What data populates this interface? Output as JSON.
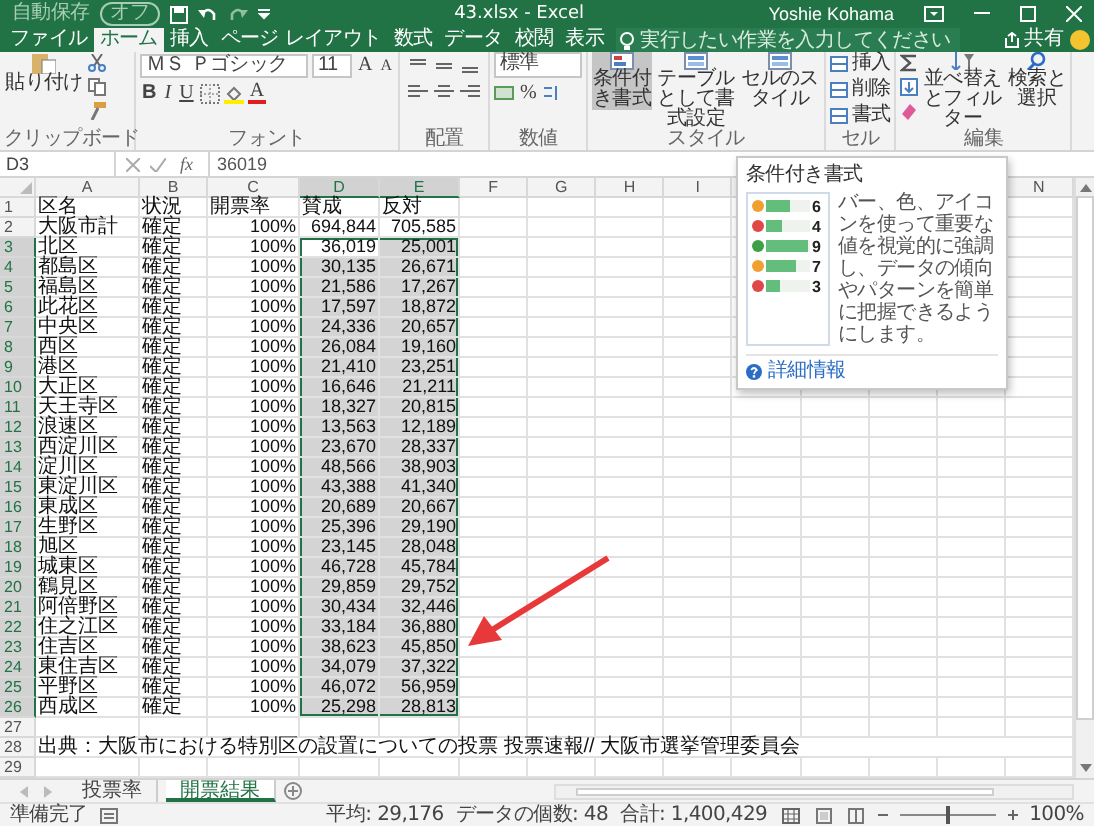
{
  "title_bar": {
    "autosave_label": "自動保存",
    "autosave_toggle": "オフ",
    "document_title": "43.xlsx - Excel",
    "user": "Yoshie Kohama"
  },
  "tabs": [
    {
      "label": "ファイル",
      "selected": false
    },
    {
      "label": "ホーム",
      "selected": true
    },
    {
      "label": "挿入",
      "selected": false
    },
    {
      "label": "ページ レイアウト",
      "selected": false
    },
    {
      "label": "数式",
      "selected": false
    },
    {
      "label": "データ",
      "selected": false
    },
    {
      "label": "校閲",
      "selected": false
    },
    {
      "label": "表示",
      "selected": false
    }
  ],
  "tell_me": {
    "placeholder": "実行したい作業を入力してください"
  },
  "share": "共有",
  "ribbon": {
    "groups": [
      {
        "kind": "clipboard",
        "label": "クリップボード",
        "buttons": [
          "貼り付け"
        ]
      },
      {
        "kind": "font",
        "label": "フォント",
        "font_name": "ＭＳ Ｐゴシック",
        "font_size": "11",
        "grow_shrink": [
          "A",
          "A"
        ],
        "styles": [
          "B",
          "I",
          "U"
        ],
        "font_color": "A"
      },
      {
        "kind": "alignment",
        "label": "配置"
      },
      {
        "kind": "number",
        "label": "数値",
        "format": "標準",
        "percent": "%"
      },
      {
        "kind": "style",
        "label": "スタイル",
        "buttons": [
          {
            "label": "条件付き書式",
            "selected": true
          },
          {
            "label": "テーブルとして書式設定",
            "selected": false
          },
          {
            "label": "セルのスタイル",
            "selected": false
          }
        ]
      },
      {
        "kind": "cells",
        "label": "セル",
        "buttons": [
          "挿入",
          "削除",
          "書式"
        ]
      },
      {
        "kind": "editing",
        "label": "編集",
        "buttons": [
          "並べ替えとフィルター",
          "検索と選択"
        ]
      }
    ]
  },
  "formula_bar": {
    "name_box": "D3",
    "function_glyph": "fx",
    "formula": "36019"
  },
  "columns": [
    {
      "label": "A",
      "selected": false
    },
    {
      "label": "B",
      "selected": false
    },
    {
      "label": "C",
      "selected": false
    },
    {
      "label": "D",
      "selected": true
    },
    {
      "label": "E",
      "selected": true
    },
    {
      "label": "F",
      "selected": false
    },
    {
      "label": "G",
      "selected": false
    },
    {
      "label": "H",
      "selected": false
    },
    {
      "label": "I",
      "selected": false
    },
    {
      "label": "N",
      "selected": false
    }
  ],
  "rows": [
    {
      "num": "1",
      "kind": "header",
      "selected": false,
      "cells": [
        "区名",
        "状況",
        "開票率",
        "賛成",
        "反対"
      ]
    },
    {
      "num": "2",
      "kind": "data",
      "selected": false,
      "cells": [
        "大阪市計",
        "確定",
        "100%",
        "694,844",
        "705,585"
      ]
    },
    {
      "num": "3",
      "kind": "data",
      "selected": true,
      "active": true,
      "cells": [
        "北区",
        "確定",
        "100%",
        "36,019",
        "25,001"
      ]
    },
    {
      "num": "4",
      "kind": "data",
      "selected": true,
      "cells": [
        "都島区",
        "確定",
        "100%",
        "30,135",
        "26,671"
      ]
    },
    {
      "num": "5",
      "kind": "data",
      "selected": true,
      "cells": [
        "福島区",
        "確定",
        "100%",
        "21,586",
        "17,267"
      ]
    },
    {
      "num": "6",
      "kind": "data",
      "selected": true,
      "cells": [
        "此花区",
        "確定",
        "100%",
        "17,597",
        "18,872"
      ]
    },
    {
      "num": "7",
      "kind": "data",
      "selected": true,
      "cells": [
        "中央区",
        "確定",
        "100%",
        "24,336",
        "20,657"
      ]
    },
    {
      "num": "8",
      "kind": "data",
      "selected": true,
      "cells": [
        "西区",
        "確定",
        "100%",
        "26,084",
        "19,160"
      ]
    },
    {
      "num": "9",
      "kind": "data",
      "selected": true,
      "cells": [
        "港区",
        "確定",
        "100%",
        "21,410",
        "23,251"
      ]
    },
    {
      "num": "10",
      "kind": "data",
      "selected": true,
      "cells": [
        "大正区",
        "確定",
        "100%",
        "16,646",
        "21,211"
      ]
    },
    {
      "num": "11",
      "kind": "data",
      "selected": true,
      "cells": [
        "天王寺区",
        "確定",
        "100%",
        "18,327",
        "20,815"
      ]
    },
    {
      "num": "12",
      "kind": "data",
      "selected": true,
      "cells": [
        "浪速区",
        "確定",
        "100%",
        "13,563",
        "12,189"
      ]
    },
    {
      "num": "13",
      "kind": "data",
      "selected": true,
      "cells": [
        "西淀川区",
        "確定",
        "100%",
        "23,670",
        "28,337"
      ]
    },
    {
      "num": "14",
      "kind": "data",
      "selected": true,
      "cells": [
        "淀川区",
        "確定",
        "100%",
        "48,566",
        "38,903"
      ]
    },
    {
      "num": "15",
      "kind": "data",
      "selected": true,
      "cells": [
        "東淀川区",
        "確定",
        "100%",
        "43,388",
        "41,340"
      ]
    },
    {
      "num": "16",
      "kind": "data",
      "selected": true,
      "cells": [
        "東成区",
        "確定",
        "100%",
        "20,689",
        "20,667"
      ]
    },
    {
      "num": "17",
      "kind": "data",
      "selected": true,
      "cells": [
        "生野区",
        "確定",
        "100%",
        "25,396",
        "29,190"
      ]
    },
    {
      "num": "18",
      "kind": "data",
      "selected": true,
      "cells": [
        "旭区",
        "確定",
        "100%",
        "23,145",
        "28,048"
      ]
    },
    {
      "num": "19",
      "kind": "data",
      "selected": true,
      "cells": [
        "城東区",
        "確定",
        "100%",
        "46,728",
        "45,784"
      ]
    },
    {
      "num": "20",
      "kind": "data",
      "selected": true,
      "cells": [
        "鶴見区",
        "確定",
        "100%",
        "29,859",
        "29,752"
      ]
    },
    {
      "num": "21",
      "kind": "data",
      "selected": true,
      "cells": [
        "阿倍野区",
        "確定",
        "100%",
        "30,434",
        "32,446"
      ]
    },
    {
      "num": "22",
      "kind": "data",
      "selected": true,
      "cells": [
        "住之江区",
        "確定",
        "100%",
        "33,184",
        "36,880"
      ]
    },
    {
      "num": "23",
      "kind": "data",
      "selected": true,
      "cells": [
        "住吉区",
        "確定",
        "100%",
        "38,623",
        "45,850"
      ]
    },
    {
      "num": "24",
      "kind": "data",
      "selected": true,
      "cells": [
        "東住吉区",
        "確定",
        "100%",
        "34,079",
        "37,322"
      ]
    },
    {
      "num": "25",
      "kind": "data",
      "selected": true,
      "cells": [
        "平野区",
        "確定",
        "100%",
        "46,072",
        "56,959"
      ]
    },
    {
      "num": "26",
      "kind": "data",
      "selected": true,
      "cells": [
        "西成区",
        "確定",
        "100%",
        "25,298",
        "28,813"
      ]
    },
    {
      "num": "27",
      "kind": "empty",
      "selected": false
    },
    {
      "num": "28",
      "kind": "note",
      "selected": false,
      "note": "出典：大阪市における特別区の設置についての投票 投票速報// 大阪市選挙管理委員会"
    },
    {
      "num": "29",
      "kind": "empty",
      "selected": false
    }
  ],
  "tooltip": {
    "title": "条件付き書式",
    "sample": [
      {
        "value": "6",
        "color": "#f0a030",
        "level": 0.55
      },
      {
        "value": "4",
        "color": "#e04848",
        "level": 0.35
      },
      {
        "value": "9",
        "color": "#3ca044",
        "level": 0.95
      },
      {
        "value": "7",
        "color": "#f0a030",
        "level": 0.7
      },
      {
        "value": "3",
        "color": "#e04848",
        "level": 0.3
      }
    ],
    "description": "バー、色、アイコンを使って重要な値を視覚的に強調し、データの傾向やパターンを簡単に把握できるようにします。",
    "link": "詳細情報"
  },
  "sheet_tabs": [
    {
      "label": "投票率",
      "selected": false
    },
    {
      "label": "開票結果",
      "selected": true
    }
  ],
  "status_bar": {
    "state": "準備完了",
    "average": "平均: 29,176",
    "count": "データの個数: 48",
    "sum": "合計: 1,400,429",
    "zoom_slider": {
      "level": 0.5
    },
    "zoom": "100%"
  }
}
